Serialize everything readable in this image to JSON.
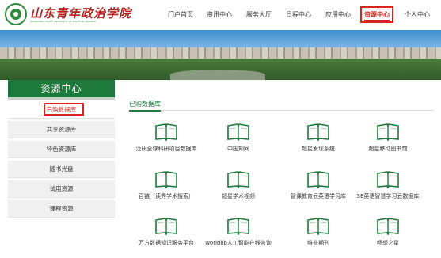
{
  "logo": {
    "text": "山东青年政治学院",
    "subtext": "SHANDONG YOUTH UNIVERSITY OF POLITICAL SCIENCE"
  },
  "nav": {
    "items": [
      "门户首页",
      "资讯中心",
      "服务大厅",
      "日程中心",
      "应用中心",
      "资源中心",
      "个人中心"
    ],
    "active": "资源中心"
  },
  "sidebar": {
    "title": "资源中心",
    "items": [
      "已购数据库",
      "共享资源库",
      "特色资源库",
      "随书光盘",
      "试用资源",
      "课程资源"
    ]
  },
  "content": {
    "tab": "已购数据库",
    "databases": [
      "泛研全球科研项目数据库",
      "中国知网",
      "超星发现系统",
      "超星移动图书馆",
      "百链（读秀学术搜索）",
      "超星学术视频",
      "智课教育云英语学习库",
      "3E英语智慧学习云数据库",
      "万方数据知识服务平台",
      "worldlib人工智能在线咨询",
      "维普期刊",
      "畅想之星"
    ]
  },
  "colors": {
    "brand_green": "#1e7a3c",
    "highlight_red": "#d9261c"
  }
}
